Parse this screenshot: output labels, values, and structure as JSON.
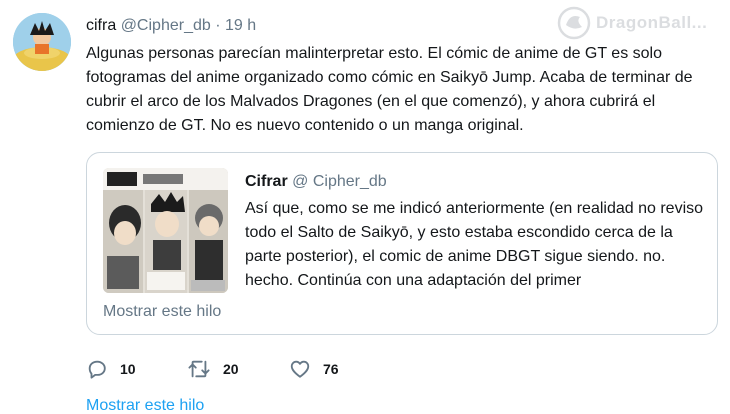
{
  "tweet": {
    "author_name": "cifra",
    "handle": "@Cipher_db",
    "separator": "·",
    "time": "19 h",
    "text": "Algunas personas parecían malinterpretar esto. El cómic de anime de GT es solo fotogramas del anime organizado como cómic en Saikyō Jump. Acaba de terminar de cubrir el arco de los Malvados Dragones (en el que comenzó), y ahora cubrirá el comienzo de GT. No es nuevo contenido o un manga original."
  },
  "watermark": {
    "text": "DragonBall..."
  },
  "quoted_tweet": {
    "author_name": "Cifrar",
    "handle": "@ Cipher_db",
    "text": "Así que, como se me indicó anteriormente (en realidad no reviso todo el Salto de Saikyō, y esto estaba escondido cerca de la parte posterior), el comic de anime DBGT sigue siendo. no. hecho. Continúa con una adaptación del primer",
    "show_thread": "Mostrar este hilo"
  },
  "actions": {
    "reply_count": "10",
    "retweet_count": "20",
    "like_count": "76",
    "reply_icon": "reply-icon",
    "retweet_icon": "retweet-icon",
    "like_icon": "heart-icon"
  },
  "footer": {
    "show_thread": "Mostrar este hilo"
  },
  "colors": {
    "link": "#1da1f2",
    "muted": "#657786",
    "border": "#ccd6dd"
  }
}
